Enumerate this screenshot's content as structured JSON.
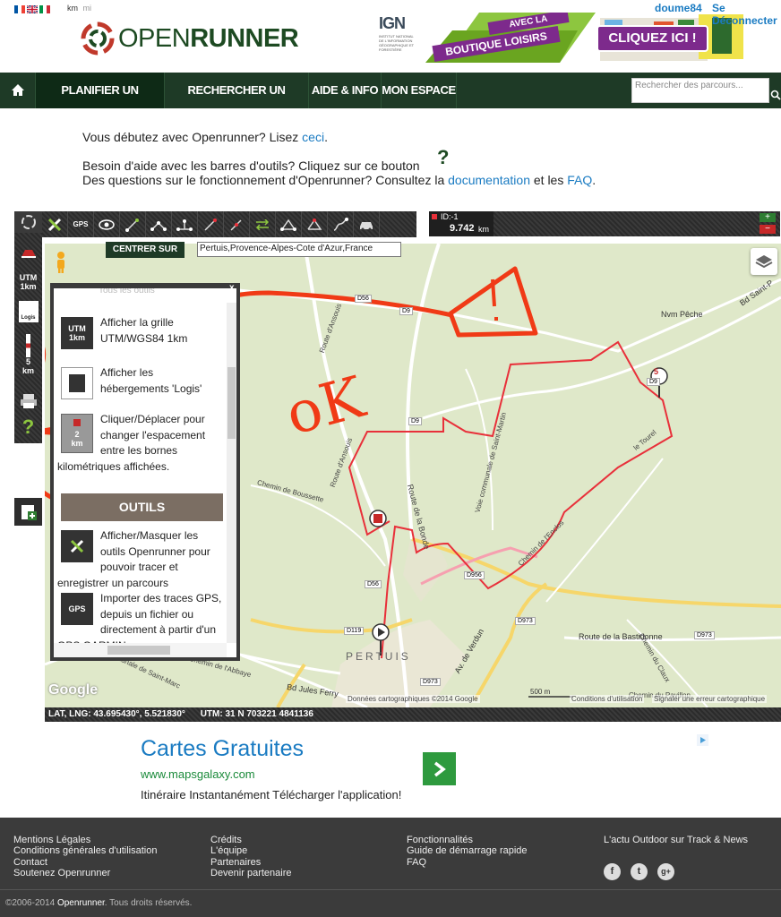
{
  "header": {
    "units": [
      "km",
      "mi"
    ],
    "logo_text_open": "OPEN",
    "logo_text_runner": "RUNNER",
    "ign_logo": "IGN",
    "ign_subtitle": "INSTITUT NATIONAL DE L'INFORMATION GÉOGRAPHIQUE ET FORESTIÈRE",
    "banner_tag1": "AVEC LA",
    "banner_tag2": "BOUTIQUE LOISIRS",
    "banner_cta": "CLIQUEZ ICI !",
    "username": "doume84",
    "logout": "Se Déconnecter"
  },
  "nav": {
    "plan": "PLANIFIER UN PARCOURS",
    "search": "RECHERCHER UN PARCOURS",
    "help": "AIDE & INFO",
    "space": "MON ESPACE",
    "search_placeholder": "Rechercher des parcours..."
  },
  "intro": {
    "line1_pre": "Vous débutez avec Openrunner? Lisez ",
    "line1_link": "ceci",
    "line1_post": ".",
    "line2": "Besoin d'aide avec les barres d'outils? Cliquez sur ce bouton",
    "line3_pre": "Des questions sur le fonctionnement d'Openrunner? Consultez la ",
    "line3_link1": "documentation",
    "line3_mid": " et les ",
    "line3_link2": "FAQ",
    "line3_post": "."
  },
  "toolbar": {
    "id_label": "ID:-1",
    "distance": "9.742",
    "distance_unit": "km",
    "gps_label": "GPS",
    "plus": "+",
    "minus": "−"
  },
  "side": {
    "utm_label": "UTM",
    "utm_unit": "1km",
    "logis_label": "Logis",
    "km_label": "5",
    "km_unit": "km",
    "help_label": "?"
  },
  "map": {
    "center_button": "CENTRER SUR",
    "center_value": "Pertuis,Provence-Alpes-Cote d'Azur,France",
    "coords": "LAT, LNG: 43.695430°, 5.521830°",
    "utm": "UTM: 31 N   703221  4841136",
    "attribution": "Données cartographiques ©2014 Google",
    "scale": "500 m",
    "terms": "Conditions d'utilisation",
    "report": "Signaler une erreur cartographique",
    "google": "Google",
    "annotation_ok": "oK",
    "annotation_warning": "!",
    "marker_5": "5",
    "place_labels": [
      "Nvm Pêche",
      "Bd Saint-P",
      "Route d'Ansouis",
      "Route d'Ansouis",
      "Chemin de Boussette",
      "Route de la Bonde",
      "Voie communale de Saint-Martin",
      "Chemin de l'Enclos",
      "Chemin de la Bastidonne",
      "Route de la Bastidonne",
      "Chemin du Claux",
      "Chemin de l'Abbaye",
      "Bd Jules Ferry",
      "Av. de Verdun",
      "Communale de Saint-Marc",
      "PERTUIS",
      "Chemin du Pavillon",
      "le Tourel",
      "D56",
      "D9",
      "D9",
      "D956",
      "D973",
      "D973",
      "D973",
      "D119",
      "D56",
      "D9"
    ]
  },
  "help_panel": {
    "top_cut": "Tous les outils",
    "utm_title": "UTM",
    "utm_sub": "1km",
    "utm_text": "Afficher la grille UTM/WGS84 1km",
    "logis_text": "Afficher les hébergements 'Logis'",
    "km_icon": "2",
    "km_unit": "km",
    "km_text": "Cliquer/Déplacer pour changer l'espacement entre les bornes kilométriques affichées.",
    "section": "OUTILS",
    "tools_text": "Afficher/Masquer les outils Openrunner pour pouvoir tracer et enregistrer un parcours",
    "gps_icon": "GPS",
    "gps_text": "Importer des traces GPS, depuis un fichier ou directement à partir d'un GPS GARMIN",
    "close": "x"
  },
  "ad": {
    "title": "Cartes Gratuites",
    "url": "www.mapsgalaxy.com",
    "desc": "Itinéraire Instantanément Télécharger l'application!"
  },
  "footer": {
    "col1": [
      "Mentions Légales",
      "Conditions générales d'utilisation",
      "Contact",
      "Soutenez Openrunner"
    ],
    "col2": [
      "Crédits",
      "L'équipe",
      "Partenaires",
      "Devenir partenaire"
    ],
    "col3": [
      "Fonctionnalités",
      "Guide de démarrage rapide",
      "FAQ"
    ],
    "col4_title": "L'actu Outdoor sur Track & News",
    "social": [
      "f",
      "t",
      "g+"
    ],
    "copyright_pre": "©2006-2014 ",
    "copyright_brand": "Openrunner",
    "copyright_post": ". Tous droits réservés."
  },
  "colors": {
    "brand_dark": "#1e3a26",
    "link": "#1a7bc2",
    "route": "#e8303a",
    "annotation": "#f03a16"
  }
}
